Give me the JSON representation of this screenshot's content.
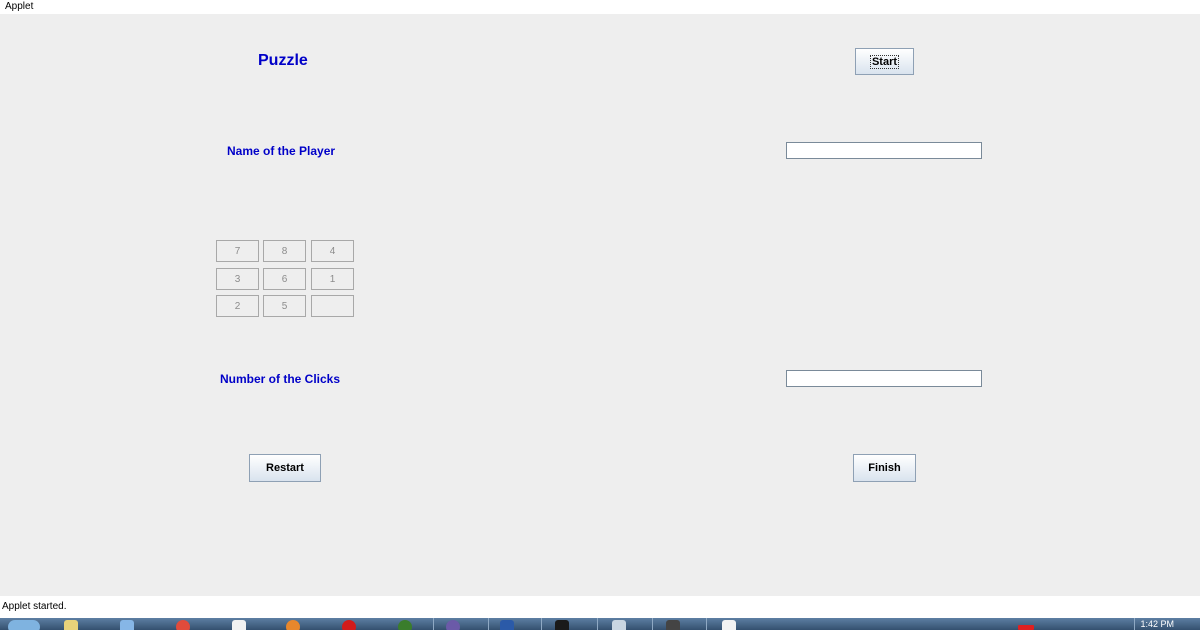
{
  "window": {
    "title": "Applet"
  },
  "applet": {
    "heading": "Puzzle",
    "start_label": "Start",
    "player_label": "Name of the Player",
    "player_value": "",
    "clicks_label": "Number of the Clicks",
    "clicks_value": "",
    "restart_label": "Restart",
    "finish_label": "Finish",
    "tiles": [
      "7",
      "8",
      "4",
      "3",
      "6",
      "1",
      "2",
      "5",
      ""
    ]
  },
  "status": {
    "text": "Applet started."
  },
  "taskbar": {
    "clock": "1:42 PM"
  }
}
